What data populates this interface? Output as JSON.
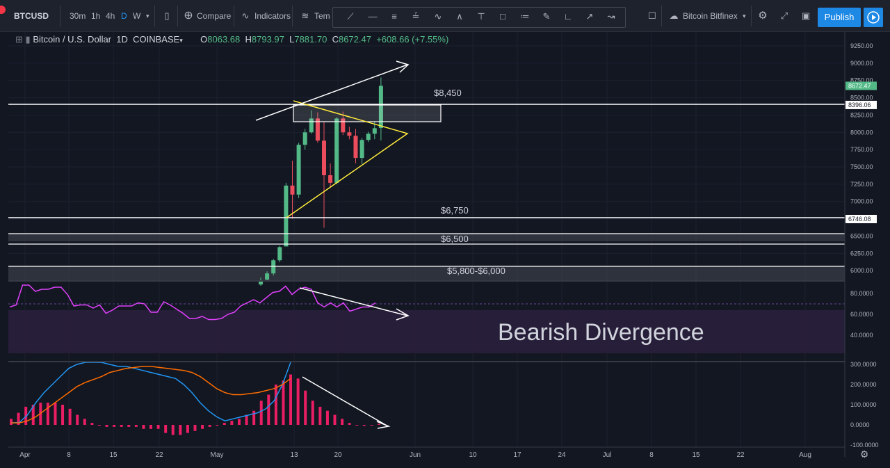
{
  "toolbar": {
    "symbol": "BTCUSD",
    "intervals": [
      "30m",
      "1h",
      "4h",
      "D",
      "W"
    ],
    "active_interval": "D",
    "compare_label": "Compare",
    "indicators_label": "Indicators",
    "templates_label": "Tem",
    "exchange_label": "Bitcoin Bitfinex",
    "publish_label": "Publish"
  },
  "legend": {
    "title": "Bitcoin / U.S. Dollar",
    "interval": "1D",
    "exchange": "COINBASE",
    "o_label": "O",
    "o_value": "8063.68",
    "h_label": "H",
    "h_value": "8793.97",
    "l_label": "L",
    "l_value": "7881.70",
    "c_label": "C",
    "c_value": "8672.47",
    "change": "+608.66 (+7.55%)"
  },
  "annotations": {
    "level_8450": "$8,450",
    "level_6750": "$6,750",
    "level_6500": "$6,500",
    "level_5800": "$5,800-$6,000",
    "bearish": "Bearish Divergence"
  },
  "colors": {
    "bg": "#131722",
    "up": "#53b987",
    "down": "#eb4d5c",
    "rsi": "#e040fb",
    "macd": "#2196f3",
    "signal": "#ff6d00",
    "hist": "#e91e63",
    "triangle": "#ffeb3b"
  },
  "chart_data": {
    "type": "candlestick",
    "symbol": "BTCUSD",
    "price_axis": {
      "ticks": [
        "9250.00",
        "9000.00",
        "8750.00",
        "8500.00",
        "8250.00",
        "8000.00",
        "7750.00",
        "7500.00",
        "7250.00",
        "7000.00",
        "6750.00",
        "6500.00",
        "6250.00",
        "6000.00"
      ],
      "ylim": [
        5800,
        9300
      ]
    },
    "price_labels": {
      "last": "8672.47",
      "level_a": "8396.06",
      "level_b": "6746.08"
    },
    "rsi_axis": {
      "ticks": [
        "80.0000",
        "60.0000",
        "40.0000"
      ]
    },
    "macd_axis": {
      "ticks": [
        "300.0000",
        "200.0000",
        "100.0000",
        "0.0000",
        "-100.0000"
      ]
    },
    "x_axis": {
      "ticks": [
        "Apr",
        "8",
        "15",
        "22",
        "May",
        "13",
        "20",
        "Jun",
        "10",
        "17",
        "24",
        "Jul",
        "8",
        "15",
        "22",
        "Aug"
      ]
    },
    "candles": [
      {
        "o": 5800,
        "h": 5900,
        "l": 5780,
        "c": 5860
      },
      {
        "o": 5870,
        "h": 5990,
        "l": 5850,
        "c": 5960
      },
      {
        "o": 5960,
        "h": 6170,
        "l": 5930,
        "c": 6150
      },
      {
        "o": 6150,
        "h": 6360,
        "l": 6120,
        "c": 6340
      },
      {
        "o": 6350,
        "h": 7270,
        "l": 6350,
        "c": 7230
      },
      {
        "o": 7230,
        "h": 7590,
        "l": 6750,
        "c": 7100
      },
      {
        "o": 7100,
        "h": 7850,
        "l": 7050,
        "c": 7820
      },
      {
        "o": 7820,
        "h": 8050,
        "l": 7750,
        "c": 8000
      },
      {
        "o": 8000,
        "h": 8320,
        "l": 7980,
        "c": 8200
      },
      {
        "o": 8200,
        "h": 8290,
        "l": 7850,
        "c": 7880
      },
      {
        "o": 7880,
        "h": 8150,
        "l": 6620,
        "c": 7380
      },
      {
        "o": 7380,
        "h": 7550,
        "l": 7200,
        "c": 7270
      },
      {
        "o": 7270,
        "h": 8220,
        "l": 7250,
        "c": 8200
      },
      {
        "o": 8200,
        "h": 8300,
        "l": 7960,
        "c": 8000
      },
      {
        "o": 8000,
        "h": 8080,
        "l": 7900,
        "c": 7950
      },
      {
        "o": 7950,
        "h": 8050,
        "l": 7550,
        "c": 7630
      },
      {
        "o": 7630,
        "h": 7920,
        "l": 7540,
        "c": 7890
      },
      {
        "o": 7890,
        "h": 8010,
        "l": 7860,
        "c": 7980
      },
      {
        "o": 7980,
        "h": 8160,
        "l": 7900,
        "c": 8060
      },
      {
        "o": 8063.68,
        "h": 8793.97,
        "l": 7881.7,
        "c": 8672.47
      }
    ],
    "rsi": [
      67,
      69,
      88,
      88,
      82,
      84,
      84,
      86,
      86,
      79,
      68,
      69,
      69,
      66,
      69,
      61,
      64,
      68,
      68,
      68,
      71,
      70,
      62,
      62,
      72,
      69,
      65,
      61,
      56,
      56,
      58,
      55,
      55,
      56,
      60,
      62,
      68,
      71,
      74,
      71,
      76,
      81,
      82,
      87,
      79,
      84,
      86,
      84,
      71,
      67,
      71,
      67,
      71,
      63,
      65,
      67,
      67,
      71
    ],
    "macd": [
      10,
      12,
      50,
      110,
      160,
      200,
      240,
      280,
      300,
      310,
      315,
      310,
      300,
      290,
      290,
      280,
      270,
      260,
      250,
      240,
      230,
      200,
      160,
      110,
      70,
      40,
      20,
      30,
      40,
      50,
      60,
      80,
      120,
      200,
      310
    ],
    "signal": [
      10,
      10,
      20,
      40,
      70,
      100,
      130,
      160,
      190,
      210,
      225,
      240,
      260,
      270,
      280,
      285,
      290,
      290,
      285,
      280,
      275,
      270,
      260,
      240,
      210,
      180,
      160,
      150,
      150,
      155,
      160,
      170,
      180,
      200,
      230
    ],
    "histogram": [
      30,
      60,
      90,
      100,
      110,
      110,
      110,
      100,
      80,
      50,
      30,
      10,
      0,
      -10,
      -10,
      -10,
      -10,
      -10,
      -20,
      -20,
      -20,
      -40,
      -50,
      -50,
      -40,
      -30,
      -20,
      -10,
      0,
      10,
      20,
      30,
      50,
      70,
      120,
      150,
      200,
      220,
      250,
      230,
      170,
      120,
      90,
      70,
      50,
      30,
      10,
      0,
      -5,
      0,
      5
    ]
  }
}
